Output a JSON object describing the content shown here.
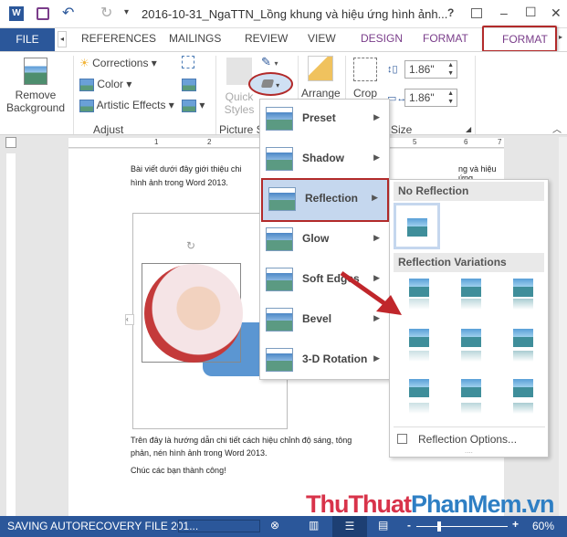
{
  "titlebar": {
    "doc_title": "2016-10-31_NgaTTN_Lồng khung và hiệu ứng hình ảnh...",
    "help": "?",
    "minimize": "–",
    "maximize": "☐",
    "close": "✕"
  },
  "tabs": {
    "file": "FILE",
    "items": [
      "REFERENCES",
      "MAILINGS",
      "REVIEW",
      "VIEW",
      "DESIGN",
      "FORMAT",
      "FORMAT"
    ],
    "active": "FORMAT"
  },
  "ribbon": {
    "remove_bg": [
      "Remove",
      "Background"
    ],
    "corrections": "Corrections",
    "color": "Color",
    "artistic": "Artistic Effects",
    "adjust_group": "Adjust",
    "quick_styles": [
      "Quick",
      "Styles"
    ],
    "picture_styles_group": "Picture St",
    "arrange": "Arrange",
    "crop": "Crop",
    "height": "1.86\"",
    "width": "1.86\"",
    "size_group": "Size"
  },
  "ruler": {
    "labels": [
      "1",
      "2",
      "5",
      "6",
      "7"
    ]
  },
  "document": {
    "para1a": "Bài viết dưới đây giới thiệu chi",
    "para1b": "ng và hiệu ứng",
    "para1c": "hình ảnh trong Word 2013.",
    "para2a": "Trên đây là hướng dẫn chi tiết cách hiệu chỉnh độ sáng, tông",
    "para2b": "phản, nén hình ảnh trong Word 2013.",
    "para3": "Chúc các bạn thành công!"
  },
  "effects_menu": {
    "items": [
      "Preset",
      "Shadow",
      "Reflection",
      "Glow",
      "Soft Edges",
      "Bevel",
      "3-D Rotation"
    ],
    "highlighted": "Reflection"
  },
  "reflection_submenu": {
    "no_reflection": "No Reflection",
    "variations": "Reflection Variations",
    "options": "Reflection Options...",
    "variation_count": 9
  },
  "status": {
    "text": "SAVING AUTORECOVERY FILE 201...",
    "zoom": "60%",
    "zoom_minus": "-",
    "zoom_plus": "+"
  },
  "watermark": {
    "part1": "ThuThuat",
    "part2": "PhanMem.vn"
  },
  "colors": {
    "brand": "#2b579a",
    "highlight": "#c5d7ee",
    "callout": "#b22a2a",
    "watermark_red": "#d8334a",
    "watermark_blue": "#2e7fc4"
  }
}
